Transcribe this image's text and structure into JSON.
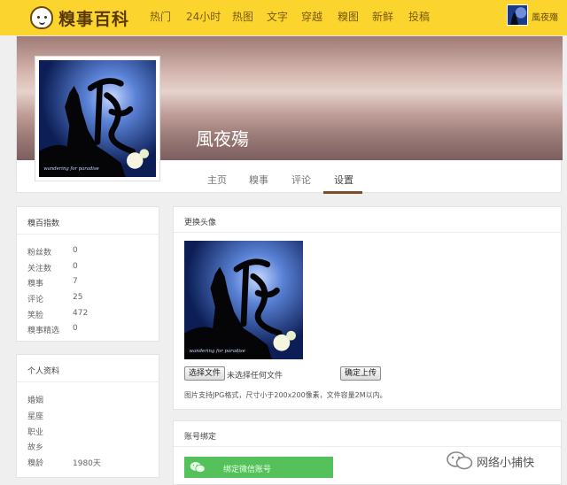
{
  "header": {
    "logo_text": "糗事百科",
    "nav": [
      "热门",
      "24小时",
      "热图",
      "文字",
      "穿越",
      "糗图",
      "新鲜",
      "投稿"
    ],
    "username": "風夜殤"
  },
  "profile": {
    "name": "風夜殤",
    "avatar_caption": "wandering for paradise",
    "tabs": [
      "主页",
      "糗事",
      "评论",
      "设置"
    ],
    "active_tab": "设置"
  },
  "sidebar": {
    "index_title": "糗百指数",
    "stats": [
      {
        "label": "粉丝数",
        "value": "0"
      },
      {
        "label": "关注数",
        "value": "0"
      },
      {
        "label": "糗事",
        "value": "7"
      },
      {
        "label": "评论",
        "value": "25"
      },
      {
        "label": "笑脸",
        "value": "472"
      },
      {
        "label": "糗事精选",
        "value": "0"
      }
    ],
    "info_title": "个人资料",
    "info": [
      {
        "label": "婚姻",
        "value": ""
      },
      {
        "label": "星座",
        "value": ""
      },
      {
        "label": "职业",
        "value": ""
      },
      {
        "label": "故乡",
        "value": ""
      },
      {
        "label": "糗龄",
        "value": "1980天"
      }
    ]
  },
  "avatar_panel": {
    "title": "更换头像",
    "choose_file": "选择文件",
    "no_file": "未选择任何文件",
    "upload": "确定上传",
    "hint": "图片支持JPG格式，尺寸小于200x200像素，文件容量2M以内。"
  },
  "binding_panel": {
    "title": "账号绑定",
    "wechat_button": "绑定微信账号"
  },
  "watermark": "网络小捕快",
  "colors": {
    "topbar": "#fbd52e",
    "wechat": "#54c15b",
    "tab_underline": "#7a4e2c"
  }
}
